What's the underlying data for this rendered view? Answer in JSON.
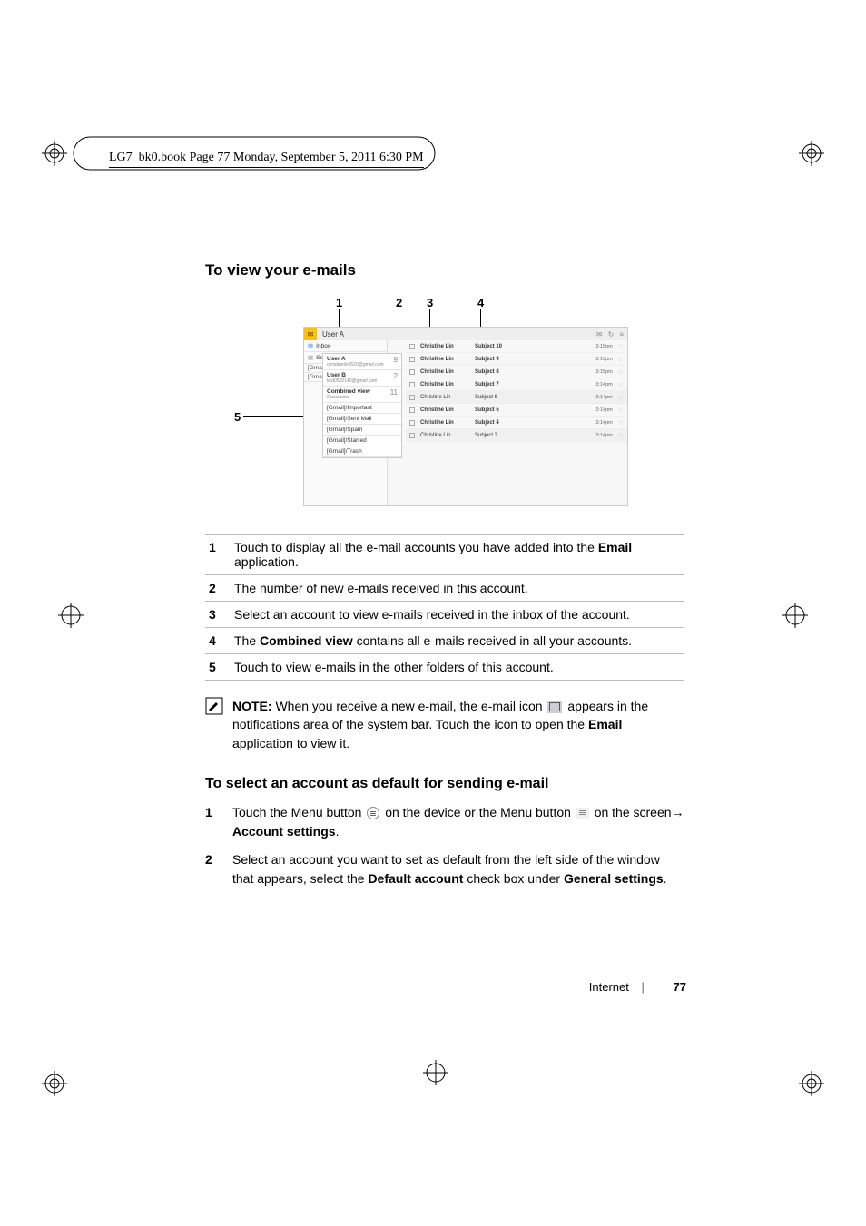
{
  "print_header": "LG7_bk0.book  Page 77  Monday, September 5, 2011  6:30 PM",
  "section1_title": "To view your e-mails",
  "callout_labels": {
    "c1": "1",
    "c2": "2",
    "c3": "3",
    "c4": "4",
    "c5": "5"
  },
  "screenshot": {
    "top_title": "User A",
    "top_icons": {
      "compose": "✉",
      "refresh": "↻",
      "menu": "≡"
    },
    "sidebar": {
      "inbox": "Inbox",
      "sent": "Sent",
      "gma1": "[Gma",
      "gma2": "[Gma",
      "accountA": {
        "name": "User A",
        "email": "christinelin0520@gmail.com",
        "count": "9"
      },
      "accountB": {
        "name": "User B",
        "email": "test0502140@gmail.com",
        "count": "2"
      },
      "combined": {
        "name": "Combined view",
        "sub": "2 accounts",
        "count": "11"
      },
      "folders": {
        "important": "[Gmail]/Important",
        "sentmail": "[Gmail]/Sent Mail",
        "spam": "[Gmail]/Spam",
        "starred": "[Gmail]/Starred",
        "trash": "[Gmail]/Trash"
      }
    },
    "rows": [
      {
        "sender": "Christine Lin",
        "subject": "Subject 10",
        "time": "3:15pm",
        "unread": true
      },
      {
        "sender": "Christine Lin",
        "subject": "Subject 9",
        "time": "3:15pm",
        "unread": true
      },
      {
        "sender": "Christine Lin",
        "subject": "Subject 8",
        "time": "3:15pm",
        "unread": true
      },
      {
        "sender": "Christine Lin",
        "subject": "Subject 7",
        "time": "3:14pm",
        "unread": true
      },
      {
        "sender": "Christine Lin",
        "subject": "Subject 6",
        "time": "3:14pm",
        "unread": false,
        "shade": true
      },
      {
        "sender": "Christine Lin",
        "subject": "Subject 5",
        "time": "3:14pm",
        "unread": true
      },
      {
        "sender": "Christine Lin",
        "subject": "Subject 4",
        "time": "3:14pm",
        "unread": true
      },
      {
        "sender": "Christine Lin",
        "subject": "Subject 3",
        "time": "3:14pm",
        "unread": false,
        "shade": true
      }
    ]
  },
  "callouts": {
    "r1a": "Touch to display all the e-mail accounts you have added into the ",
    "r1b": "Email",
    "r1c": " application.",
    "r2": "The number of new e-mails received in this account.",
    "r3": "Select an account to view e-mails received in the inbox of the account.",
    "r4a": "The ",
    "r4b": "Combined view",
    "r4c": " contains all e-mails received in all your accounts.",
    "r5": "Touch to view e-mails in the other folders of this account."
  },
  "note": {
    "label": "NOTE:",
    "part1": " When you receive a new e-mail, the e-mail icon ",
    "part2": " appears in the notifications area of the system bar. Touch the icon to open the ",
    "bold": "Email",
    "part3": " application to view it."
  },
  "section2_title": "To select an account as default for sending e-mail",
  "steps": {
    "s1num": "1",
    "s1a": "Touch the Menu button ",
    "s1b": " on the device or the Menu button ",
    "s1c": " on the screen",
    "s1arrow": "→ ",
    "s1d": "Account settings",
    "s1e": ".",
    "s2num": "2",
    "s2a": "Select an account you want to set as default from the left side of the window that appears, select the ",
    "s2b": "Default account",
    "s2c": " check box under ",
    "s2d": "General settings",
    "s2e": "."
  },
  "footer": {
    "section": "Internet",
    "page": "77"
  }
}
